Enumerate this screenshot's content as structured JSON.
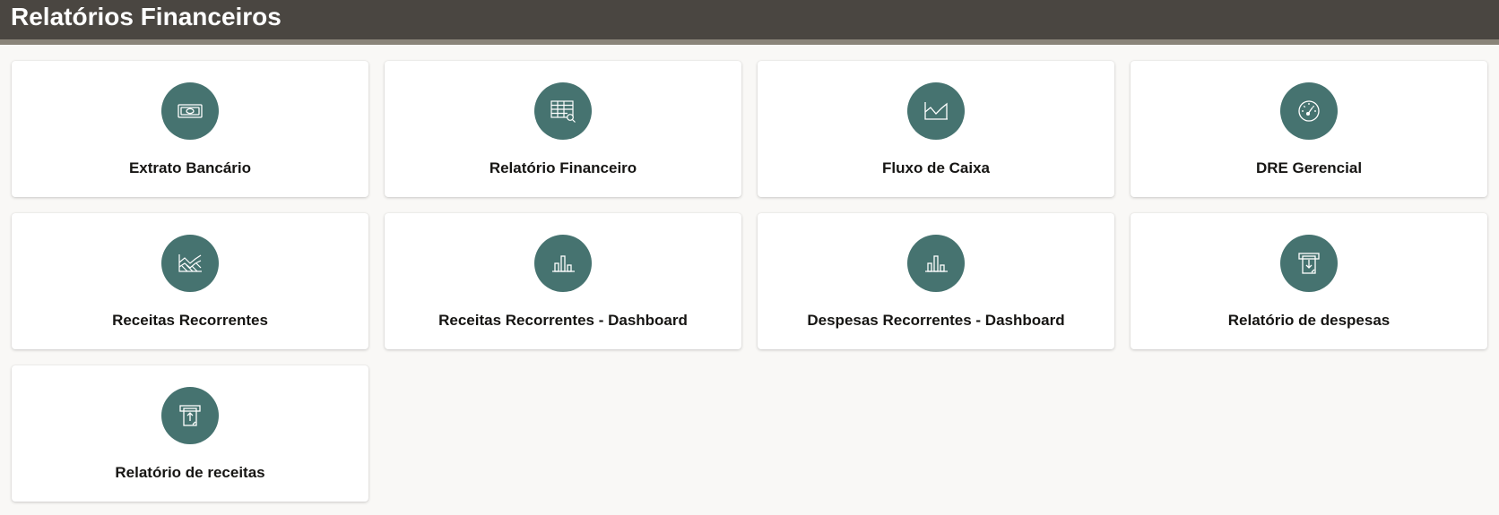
{
  "header": {
    "title": "Relatórios Financeiros"
  },
  "colors": {
    "header_bg": "#4a4641",
    "header_stripe": "#8a8479",
    "icon_bg": "#467370",
    "page_bg": "#f9f8f6"
  },
  "cards": [
    {
      "label": "Extrato Bancário",
      "icon": "money-bill-icon"
    },
    {
      "label": "Relatório Financeiro",
      "icon": "table-search-icon"
    },
    {
      "label": "Fluxo de Caixa",
      "icon": "area-chart-icon"
    },
    {
      "label": "DRE Gerencial",
      "icon": "gauge-icon"
    },
    {
      "label": "Receitas Recorrentes",
      "icon": "multi-area-chart-icon"
    },
    {
      "label": "Receitas Recorrentes - Dashboard",
      "icon": "bar-chart-icon"
    },
    {
      "label": "Despesas Recorrentes - Dashboard",
      "icon": "bar-chart-icon"
    },
    {
      "label": "Relatório de despesas",
      "icon": "withdraw-icon"
    },
    {
      "label": "Relatório de receitas",
      "icon": "deposit-icon"
    }
  ]
}
